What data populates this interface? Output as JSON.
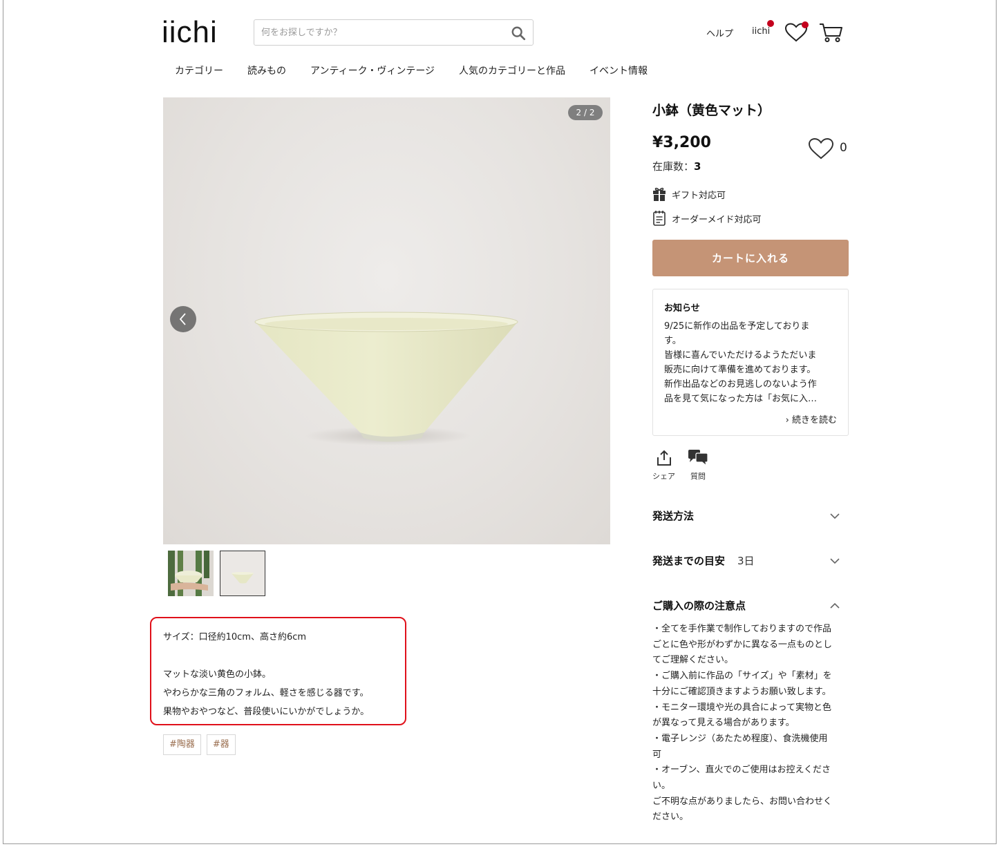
{
  "header": {
    "logo": "iichi",
    "search_placeholder": "何をお探しですか？",
    "help": "ヘルプ",
    "user": "iichi"
  },
  "nav": [
    "カテゴリー",
    "読みもの",
    "アンティーク・ヴィンテージ",
    "人気のカテゴリーと作品",
    "イベント情報"
  ],
  "gallery": {
    "counter": "2 / 2"
  },
  "description": {
    "lines": [
      "サイズ：口径約10cm、高さ約6cm",
      "",
      "マットな淡い黄色の小鉢。",
      "やわらかな三角のフォルム、軽さを感じる器です。",
      "果物やおやつなど、普段使いにいかがでしょうか。"
    ]
  },
  "tags": [
    "#陶器",
    "#器"
  ],
  "product": {
    "title": "小鉢（黄色マット）",
    "price": "¥3,200",
    "stock_label": "在庫数：",
    "stock_value": "3",
    "favorite_count": "0",
    "gift": "ギフト対応可",
    "order": "オーダーメイド対応可",
    "cart_button": "カートに入れる"
  },
  "notice": {
    "title": "お知らせ",
    "lines": [
      "9/25に新作の出品を予定しておりま",
      "す。",
      "皆様に喜んでいただけるようただいま",
      "販売に向けて準備を進めております。",
      "新作出品などのお見逃しのないよう作",
      "品を見て気になった方は「お気に入…"
    ],
    "more": "› 続きを読む"
  },
  "actions": {
    "share": "シェア",
    "question": "質問"
  },
  "accordion": {
    "shipping_method": "発送方法",
    "shipping_time_label": "発送までの目安",
    "shipping_time_value": "3日",
    "caution_title": "ご購入の際の注意点"
  },
  "caution_lines": [
    "・全てを手作業で制作しておりますので作品",
    "ごとに色や形がわずかに異なる一点ものとし",
    "てご理解ください。",
    "・ご購入前に作品の「サイズ」や「素材」を",
    "十分にご確認頂きますようお願い致します。",
    "・モニター環境や光の具合によって実物と色",
    "が異なって見える場合があります。",
    "・電子レンジ（あたため程度）、食洗機使用",
    "可",
    "・オーブン、直火でのご使用はお控えくださ",
    "い。",
    "ご不明な点がありましたら、お問い合わせく",
    "ださい。"
  ],
  "colors": {
    "accent": "#c59476",
    "tag_text": "#9a6e4f",
    "notification_dot": "#c4001d",
    "highlight_border": "#e0101a"
  }
}
